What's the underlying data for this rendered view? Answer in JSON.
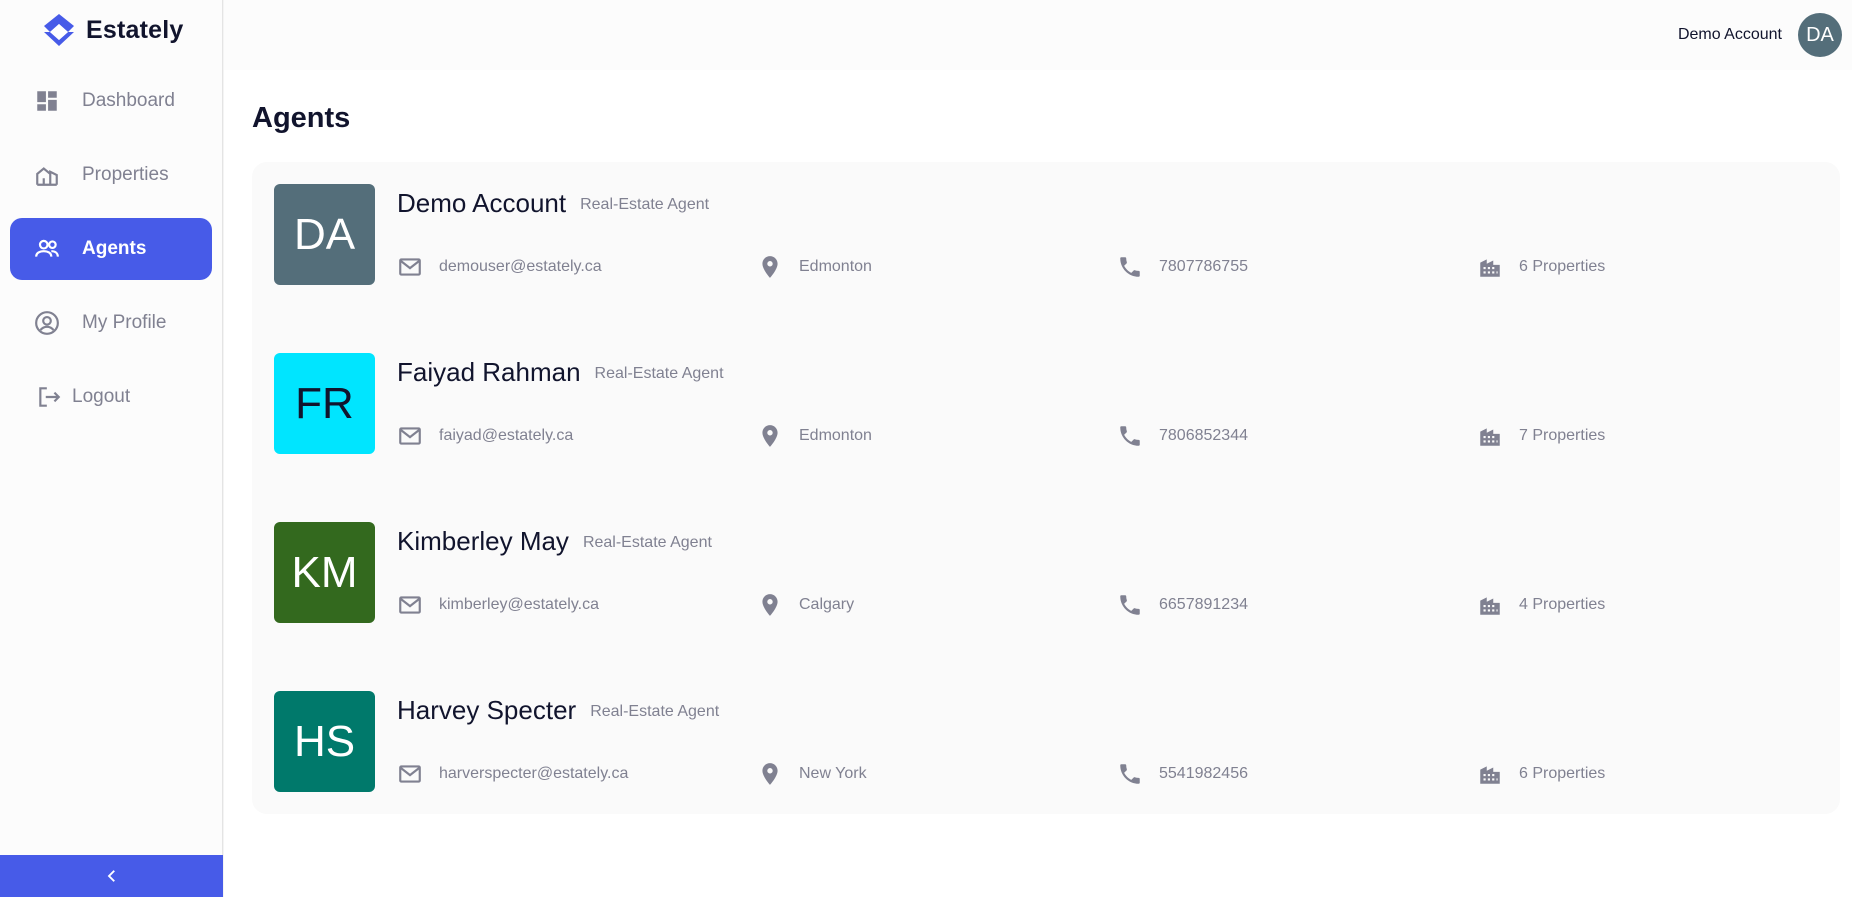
{
  "app": {
    "name": "Estately"
  },
  "sidebar": {
    "items": [
      {
        "label": "Dashboard",
        "icon": "dashboard-icon",
        "active": false
      },
      {
        "label": "Properties",
        "icon": "property-icon",
        "active": false
      },
      {
        "label": "Agents",
        "icon": "people-icon",
        "active": true
      },
      {
        "label": "My Profile",
        "icon": "account-circle-icon",
        "active": false
      },
      {
        "label": "Logout",
        "icon": "logout-icon",
        "active": false
      }
    ],
    "collapse_icon": "chevron-left-icon"
  },
  "header": {
    "user_name": "Demo Account",
    "avatar_initials": "DA"
  },
  "page": {
    "title": "Agents"
  },
  "agents": [
    {
      "initials": "DA",
      "name": "Demo Account",
      "role": "Real-Estate Agent",
      "email": "demouser@estately.ca",
      "location": "Edmonton",
      "phone": "7807786755",
      "properties": "6 Properties",
      "color": "#546e7a"
    },
    {
      "initials": "FR",
      "name": "Faiyad Rahman",
      "role": "Real-Estate Agent",
      "email": "faiyad@estately.ca",
      "location": "Edmonton",
      "phone": "7806852344",
      "properties": "7 Properties",
      "color": "#00e5ff"
    },
    {
      "initials": "KM",
      "name": "Kimberley May",
      "role": "Real-Estate Agent",
      "email": "kimberley@estately.ca",
      "location": "Calgary",
      "phone": "6657891234",
      "properties": "4 Properties",
      "color": "#33691e"
    },
    {
      "initials": "HS",
      "name": "Harvey Specter",
      "role": "Real-Estate Agent",
      "email": "harverspecter@estately.ca",
      "location": "New York",
      "phone": "5541982456",
      "properties": "6 Properties",
      "color": "#00796b"
    }
  ],
  "colors": {
    "accent": "#475be8",
    "text": "#11142d",
    "muted": "#808191"
  }
}
